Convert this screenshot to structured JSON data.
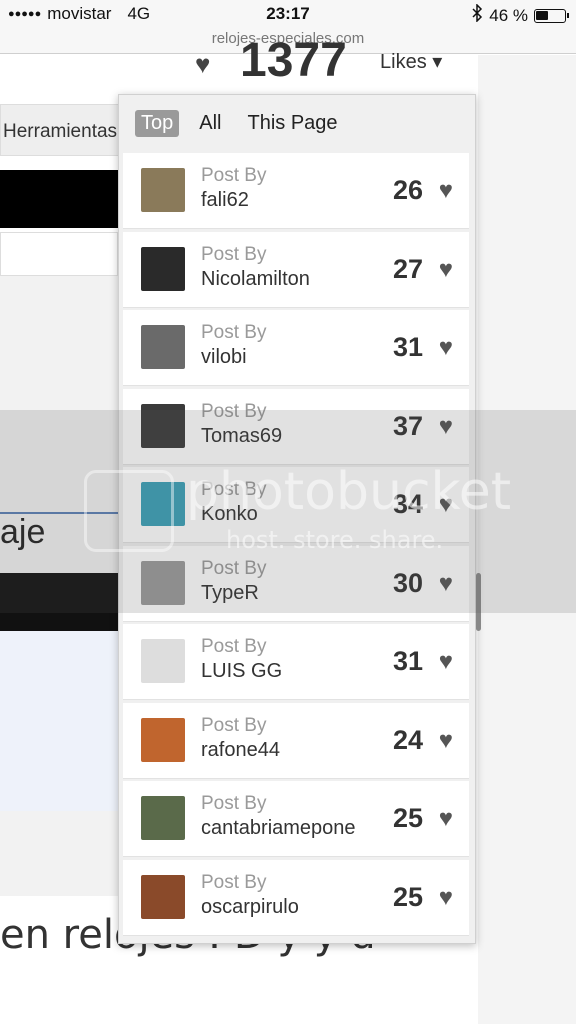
{
  "status_bar": {
    "signal": "●●●●●",
    "carrier": "movistar",
    "network": "4G",
    "time": "23:17",
    "bluetooth_icon": "bluetooth-icon",
    "battery_percent": "46 %",
    "battery_level": 0.46
  },
  "url": "relojes-especiales.com",
  "likes_header": {
    "count": "1377",
    "label": "Likes"
  },
  "background": {
    "tab_label": "Herramientas",
    "title_fragment": "aje",
    "bottom_text": "en relojes : D y y d"
  },
  "panel": {
    "tabs": [
      {
        "label": "Top",
        "active": true
      },
      {
        "label": "All",
        "active": false
      },
      {
        "label": "This Page",
        "active": false
      }
    ],
    "post_by_label": "Post By",
    "items": [
      {
        "user": "fali62",
        "count": "26",
        "thumb_color": "#8a7a5a"
      },
      {
        "user": "Nicolamilton",
        "count": "27",
        "thumb_color": "#2a2a2a"
      },
      {
        "user": "vilobi",
        "count": "31",
        "thumb_color": "#6a6a6a"
      },
      {
        "user": "Tomas69",
        "count": "37",
        "thumb_color": "#3a3a3a"
      },
      {
        "user": "Konko",
        "count": "34",
        "thumb_color": "#3aa0b8"
      },
      {
        "user": "TypeR",
        "count": "30",
        "thumb_color": "#9a9a9a"
      },
      {
        "user": "LUIS GG",
        "count": "31",
        "thumb_color": "#dddddd"
      },
      {
        "user": "rafone44",
        "count": "24",
        "thumb_color": "#c0652e"
      },
      {
        "user": "cantabriamepone",
        "count": "25",
        "thumb_color": "#5a6a4a"
      },
      {
        "user": "oscarpirulo",
        "count": "25",
        "thumb_color": "#8a4a2a"
      }
    ]
  },
  "watermark": {
    "main": "photobucket",
    "sub": "host. store. share."
  }
}
